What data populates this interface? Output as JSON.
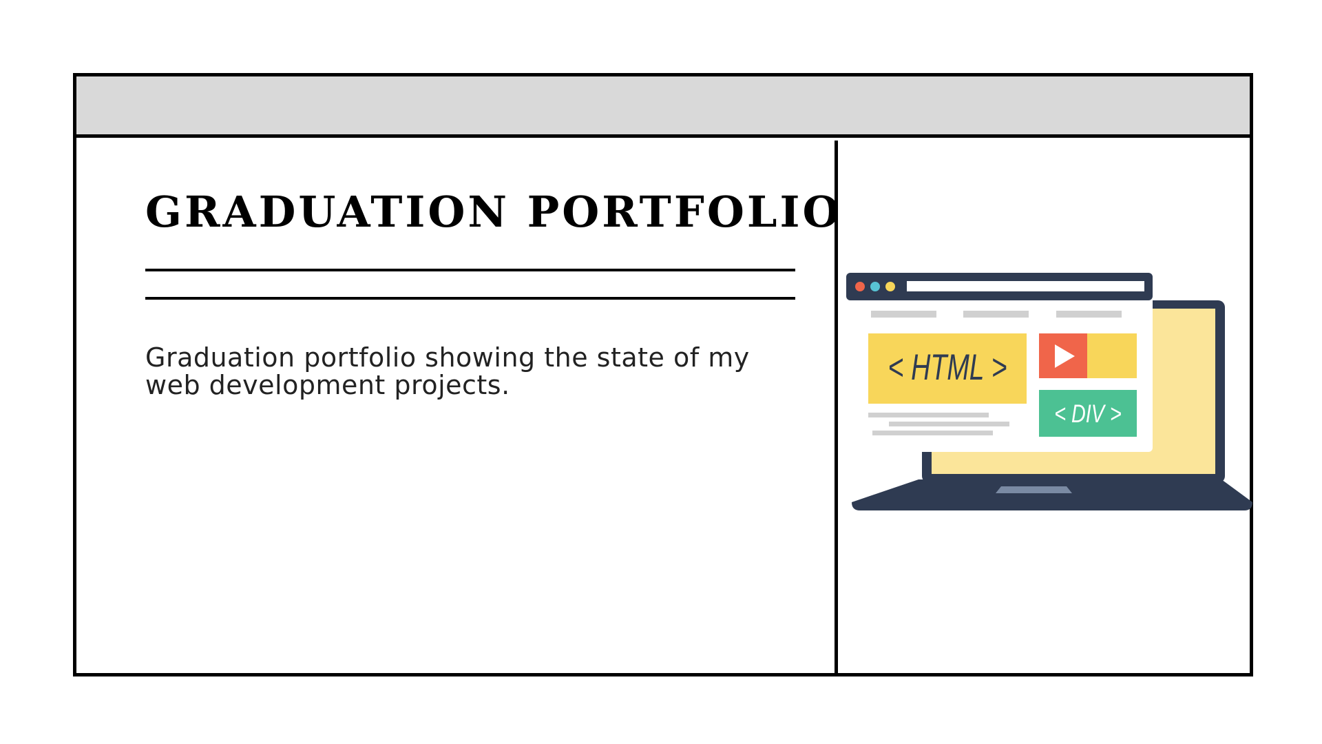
{
  "slide": {
    "title": "GRADUATION PORTFOLIO",
    "description": "Graduation portfolio showing the state of my web development projects."
  },
  "illustration": {
    "html_tag": "< HTML >",
    "div_tag": "< DIV >",
    "colors": {
      "laptop_body": "#2f3b52",
      "screen": "#fbe59a",
      "yellow_block": "#f8d65a",
      "red_play": "#f0654a",
      "green_block": "#4cc193",
      "browser_bar": "#2f3b52"
    }
  }
}
